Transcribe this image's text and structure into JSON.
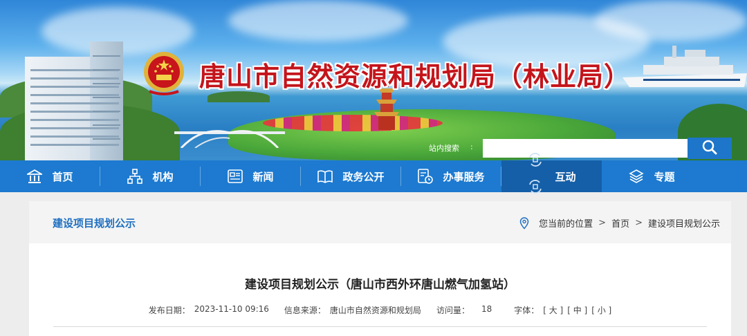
{
  "header": {
    "site_title": "唐山市自然资源和规划局（林业局）",
    "search_label": "站内搜索",
    "search_colon": ":",
    "search_placeholder": ""
  },
  "nav": {
    "items": [
      {
        "label": "首页",
        "icon": "home-icon"
      },
      {
        "label": "机构",
        "icon": "org-chart-icon"
      },
      {
        "label": "新闻",
        "icon": "news-icon"
      },
      {
        "label": "政务公开",
        "icon": "book-icon"
      },
      {
        "label": "办事服务",
        "icon": "service-icon"
      },
      {
        "label": "互动",
        "icon": "interaction-icon",
        "active": true
      },
      {
        "label": "专题",
        "icon": "layers-icon"
      }
    ]
  },
  "breadcrumb": {
    "section_title": "建设项目规划公示",
    "location_label": "您当前的位置",
    "separator": ">",
    "home": "首页",
    "current": "建设项目规划公示"
  },
  "article": {
    "title": "建设项目规划公示（唐山市西外环唐山燃气加氢站）",
    "publish_label": "发布日期：",
    "publish_date": "2023-11-10 09:16",
    "source_label": "信息来源：",
    "source": "唐山市自然资源和规划局",
    "views_label": "访问量：",
    "views": "18",
    "fontsize_label": "字体：",
    "font_large": "[ 大 ]",
    "font_medium": "[ 中 ]",
    "font_small": "[ 小 ]"
  },
  "colors": {
    "nav_bg": "#1d7ad0",
    "nav_active": "#155fa8",
    "title_red": "#c4141b",
    "section_blue": "#1d6fc0"
  }
}
